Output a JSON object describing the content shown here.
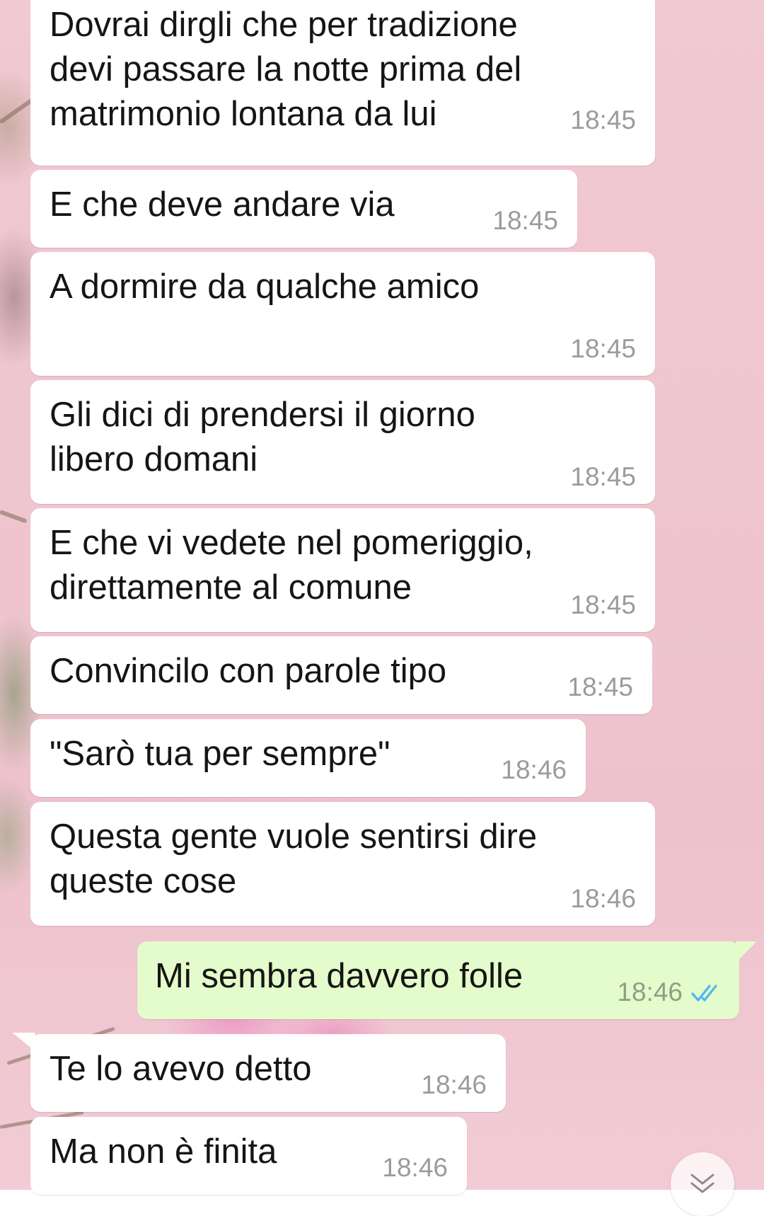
{
  "chat": {
    "messages": [
      {
        "direction": "incoming",
        "text": "Dovrai dirgli che per tradizione\ndevi passare la notte prima del\nmatrimonio lontana da lui",
        "time": "18:45"
      },
      {
        "direction": "incoming",
        "text": "E che deve andare via",
        "time": "18:45"
      },
      {
        "direction": "incoming",
        "text": "A dormire da qualche amico",
        "time": "18:45"
      },
      {
        "direction": "incoming",
        "text": "Gli dici di prendersi il giorno\nlibero domani",
        "time": "18:45"
      },
      {
        "direction": "incoming",
        "text": "E che vi vedete nel pomeriggio,\ndirettamente al comune",
        "time": "18:45"
      },
      {
        "direction": "incoming",
        "text": "Convincilo con parole tipo",
        "time": "18:45"
      },
      {
        "direction": "incoming",
        "text": "\"Sarò tua per sempre\"",
        "time": "18:46"
      },
      {
        "direction": "incoming",
        "text": "Questa gente vuole sentirsi dire\nqueste cose",
        "time": "18:46"
      },
      {
        "direction": "outgoing",
        "text": "Mi sembra davvero folle",
        "time": "18:46",
        "status": "read"
      },
      {
        "direction": "incoming",
        "text": "Te lo avevo detto",
        "time": "18:46"
      },
      {
        "direction": "incoming",
        "text": "Ma non è finita",
        "time": "18:46"
      }
    ]
  },
  "icons": {
    "read_receipt": "double-check-icon",
    "scroll_down": "chevron-double-down-icon"
  },
  "colors": {
    "incoming_bubble": "#ffffff",
    "outgoing_bubble": "#e4fbcb",
    "read_tick": "#4fb6ec",
    "timestamp": "#9b9b9b",
    "wallpaper": "#efc5cf"
  }
}
